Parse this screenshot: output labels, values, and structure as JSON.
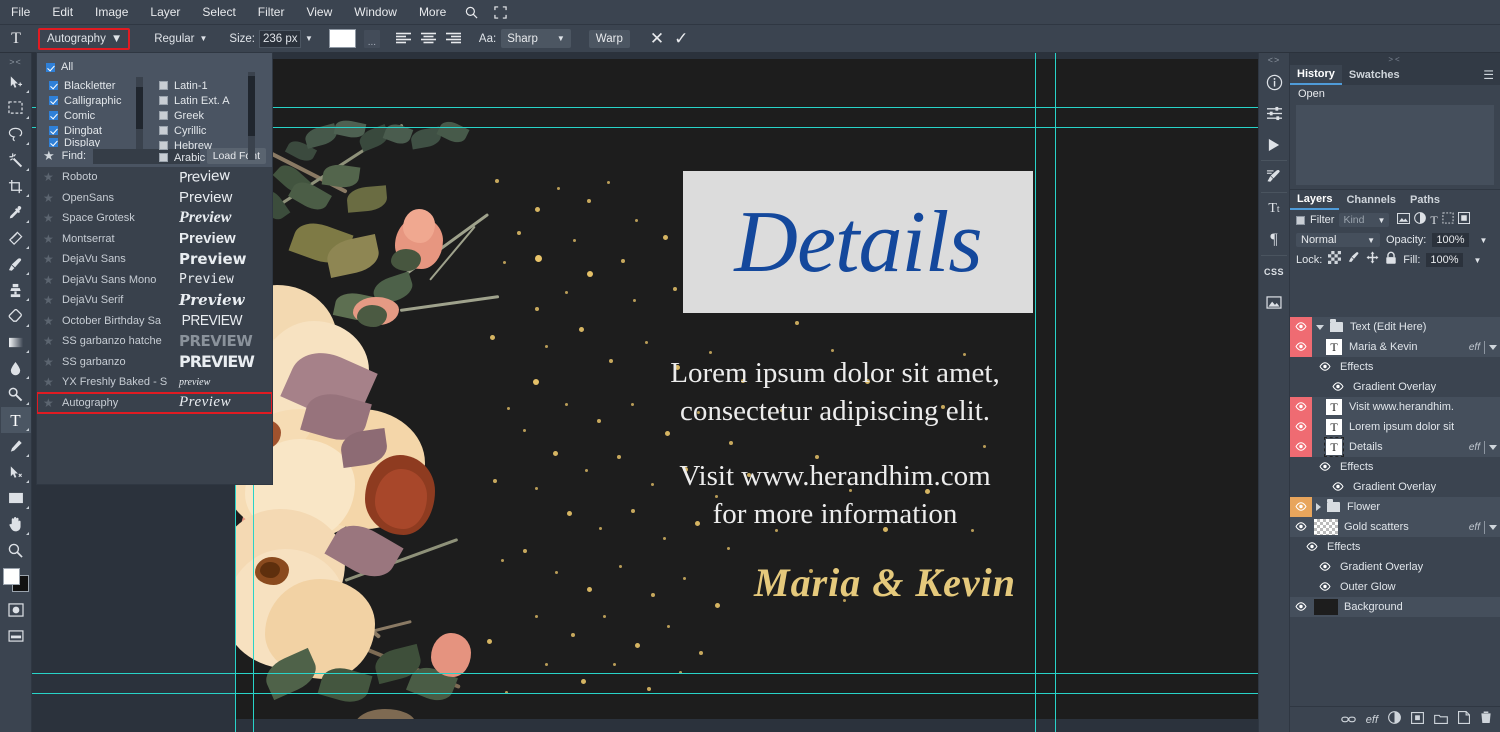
{
  "menubar": {
    "items": [
      "File",
      "Edit",
      "Image",
      "Layer",
      "Select",
      "Filter",
      "View",
      "Window",
      "More"
    ],
    "search_icon": "search-icon",
    "fullscreen_icon": "fullscreen-icon"
  },
  "options_bar": {
    "tool_icon": "T",
    "font_family": "Autography",
    "font_style": "Regular",
    "size_label": "Size:",
    "size_value": "236 px",
    "color_swatch": "#ffffff",
    "more_label": "...",
    "align_left": "align-left-icon",
    "align_center": "align-center-icon",
    "align_right": "align-right-icon",
    "aa_label": "Aa:",
    "aa_value": "Sharp",
    "warp_label": "Warp",
    "cancel_label": "✕",
    "commit_label": "✓"
  },
  "left_tools": [
    {
      "name": "move-tool",
      "glyph": "move"
    },
    {
      "name": "marquee-tool",
      "glyph": "marquee"
    },
    {
      "name": "lasso-tool",
      "glyph": "lasso"
    },
    {
      "name": "magic-wand-tool",
      "glyph": "wand"
    },
    {
      "name": "crop-tool",
      "glyph": "crop"
    },
    {
      "name": "eyedropper-tool",
      "glyph": "eyedropper"
    },
    {
      "name": "healing-brush-tool",
      "glyph": "heal"
    },
    {
      "name": "brush-tool",
      "glyph": "brush"
    },
    {
      "name": "clone-stamp-tool",
      "glyph": "stamp"
    },
    {
      "name": "eraser-tool",
      "glyph": "eraser"
    },
    {
      "name": "gradient-tool",
      "glyph": "gradient"
    },
    {
      "name": "blur-tool",
      "glyph": "blur"
    },
    {
      "name": "dodge-tool",
      "glyph": "dodge"
    },
    {
      "name": "pen-tool",
      "glyph": "pen"
    },
    {
      "name": "type-tool",
      "glyph": "type",
      "selected": true
    },
    {
      "name": "path-select-tool",
      "glyph": "pathselect"
    },
    {
      "name": "shape-tool",
      "glyph": "shape"
    },
    {
      "name": "hand-tool",
      "glyph": "hand"
    },
    {
      "name": "zoom-tool",
      "glyph": "zoom"
    }
  ],
  "font_panel": {
    "all_label": "All",
    "categories_left": [
      {
        "label": "Blackletter",
        "checked": true
      },
      {
        "label": "Calligraphic",
        "checked": true
      },
      {
        "label": "Comic",
        "checked": true
      },
      {
        "label": "Dingbat",
        "checked": true
      },
      {
        "label": "Display",
        "checked": true
      }
    ],
    "categories_right": [
      {
        "label": "Latin-1",
        "checked": false
      },
      {
        "label": "Latin Ext. A",
        "checked": false
      },
      {
        "label": "Greek",
        "checked": false
      },
      {
        "label": "Cyrillic",
        "checked": false
      },
      {
        "label": "Hebrew",
        "checked": false
      },
      {
        "label": "Arabic",
        "checked": false
      }
    ],
    "find_label": "Find:",
    "find_value": "",
    "load_font_label": "Load Font",
    "fonts": [
      {
        "name": "Roboto",
        "preview": "Preview",
        "style": "handdrawn"
      },
      {
        "name": "OpenSans",
        "preview": "Preview",
        "style": "sans"
      },
      {
        "name": "Space Grotesk",
        "preview": "Preview",
        "style": "bolditalic-serif"
      },
      {
        "name": "Montserrat",
        "preview": "Preview",
        "style": "bold-sans"
      },
      {
        "name": "DejaVu Sans",
        "preview": "Preview",
        "style": "bold-dejavu"
      },
      {
        "name": "DejaVu Sans Mono",
        "preview": "Preview",
        "style": "mono"
      },
      {
        "name": "DejaVu Serif",
        "preview": "Preview",
        "style": "bolditalic-serif2"
      },
      {
        "name": "October Birthday Sa",
        "preview": "PREVIEW",
        "style": "condensed-caps"
      },
      {
        "name": "SS garbanzo hatche",
        "preview": "PREVIEW",
        "style": "hatched-caps"
      },
      {
        "name": "SS garbanzo",
        "preview": "PREVIEW",
        "style": "heavy-caps"
      },
      {
        "name": "YX Freshly Baked - S",
        "preview": "preview",
        "style": "tiny-script"
      },
      {
        "name": "Autography",
        "preview": "Preview",
        "style": "script",
        "highlighted": true
      }
    ]
  },
  "canvas": {
    "details_text": "Details",
    "lorem_line1": "Lorem ipsum dolor sit amet,",
    "lorem_line2": "consectetur adipiscing elit.",
    "visit_line1": "Visit www.herandhim.com",
    "visit_line2": "for more information",
    "signature": "Maria & Kevin",
    "background_color": "#1d1d1d",
    "details_color": "#14489c",
    "details_box_color": "#dcdcdc",
    "signature_color": "#e5c97c",
    "body_text_color": "#ececec",
    "guide_color": "#28d3c8"
  },
  "right_strip": {
    "collapse_label": "<>",
    "icons": [
      "info-icon",
      "adjustments-icon",
      "actions-play-icon",
      "brush-presets-icon",
      "character-icon",
      "paragraph-icon",
      "css-icon",
      "image-icon"
    ]
  },
  "history_panel": {
    "grip": "><",
    "tabs": [
      {
        "label": "History",
        "active": true
      },
      {
        "label": "Swatches",
        "active": false
      }
    ],
    "menu_icon": "hamburger-icon",
    "items": [
      "Open"
    ]
  },
  "layers_panel": {
    "tabs": [
      {
        "label": "Layers",
        "active": true
      },
      {
        "label": "Channels",
        "active": false
      },
      {
        "label": "Paths",
        "active": false
      }
    ],
    "filter_label": "Filter",
    "kind_value": "Kind",
    "kind_icons": [
      "pixel-filter-icon",
      "adjustment-filter-icon",
      "type-filter-icon",
      "shape-filter-icon",
      "smart-object-filter-icon"
    ],
    "blend_mode": "Normal",
    "opacity_label": "Opacity:",
    "opacity_value": "100%",
    "lock_label": "Lock:",
    "lock_icons": [
      "lock-transparency-icon",
      "lock-pixels-icon",
      "lock-position-icon",
      "lock-all-icon"
    ],
    "fill_label": "Fill:",
    "fill_value": "100%",
    "rows": [
      {
        "label": "Text (Edit Here)",
        "type": "group",
        "indent": 0,
        "eye": "red",
        "thumb": "folder",
        "disclosure": "down",
        "eff": ""
      },
      {
        "label": "Maria & Kevin",
        "type": "layer",
        "indent": 1,
        "eye": "red",
        "thumb": "T",
        "eff": "eff"
      },
      {
        "label": "Effects",
        "type": "effects",
        "indent": 2,
        "eye": "plain",
        "thumb": "none",
        "eff": ""
      },
      {
        "label": "Gradient Overlay",
        "type": "effect",
        "indent": 3,
        "eye": "plain",
        "thumb": "none",
        "eff": ""
      },
      {
        "label": "Visit www.herandhim.",
        "type": "layer",
        "indent": 1,
        "eye": "red",
        "thumb": "T",
        "eff": ""
      },
      {
        "label": "Lorem ipsum dolor sit",
        "type": "layer",
        "indent": 1,
        "eye": "red",
        "thumb": "T",
        "eff": ""
      },
      {
        "label": "Details",
        "type": "layer",
        "indent": 1,
        "eye": "red",
        "thumb": "T-dashed",
        "eff": "eff"
      },
      {
        "label": "Effects",
        "type": "effects",
        "indent": 2,
        "eye": "plain",
        "thumb": "none",
        "eff": ""
      },
      {
        "label": "Gradient Overlay",
        "type": "effect",
        "indent": 3,
        "eye": "plain",
        "thumb": "none",
        "eff": ""
      },
      {
        "label": "Flower",
        "type": "group",
        "indent": 0,
        "eye": "orange",
        "thumb": "folder",
        "disclosure": "right",
        "eff": ""
      },
      {
        "label": "Gold scatters",
        "type": "layer",
        "indent": 0,
        "eye": "plain",
        "thumb": "checker",
        "eff": "eff"
      },
      {
        "label": "Effects",
        "type": "effects",
        "indent": 1,
        "eye": "plain",
        "thumb": "none",
        "eff": ""
      },
      {
        "label": "Gradient Overlay",
        "type": "effect",
        "indent": 2,
        "eye": "plain",
        "thumb": "none",
        "eff": ""
      },
      {
        "label": "Outer Glow",
        "type": "effect",
        "indent": 2,
        "eye": "plain",
        "thumb": "none",
        "eff": ""
      },
      {
        "label": "Background",
        "type": "layer",
        "indent": 0,
        "eye": "plain",
        "thumb": "black",
        "eff": ""
      }
    ],
    "bottom_icons": [
      "link-layers-icon",
      "layer-style-fx-icon",
      "adjustment-layer-icon",
      "layer-mask-icon",
      "new-group-icon",
      "new-layer-icon",
      "delete-layer-icon"
    ],
    "fx_label": "eff"
  }
}
